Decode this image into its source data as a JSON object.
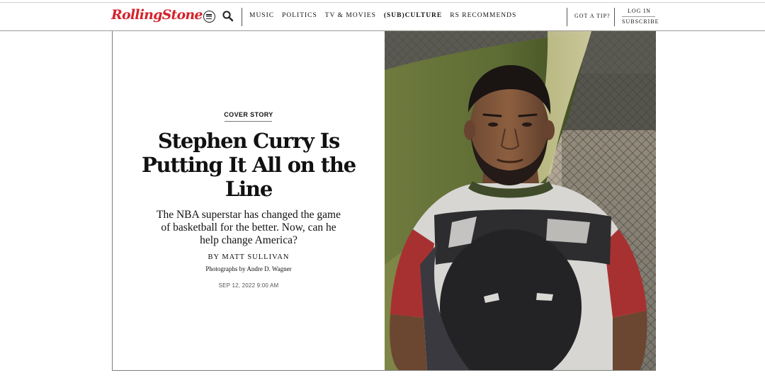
{
  "header": {
    "logo": "RollingStone",
    "nav": [
      "MUSIC",
      "POLITICS",
      "TV & MOVIES",
      "(SUB)CULTURE",
      "RS RECOMMENDS"
    ],
    "tip": "GOT A TIP?",
    "login": "LOG IN",
    "subscribe": "SUBSCRIBE"
  },
  "article": {
    "kicker": "COVER STORY",
    "headline": "Stephen Curry Is Putting It All on the Line",
    "dek": "The NBA superstar has changed the game of basketball for the better. Now, can he help change America?",
    "byline": "BY MATT SULLIVAN",
    "photo_credit": "Photographs by Andre D. Wagner",
    "date": "SEP 12, 2022 9:00 AM"
  },
  "icons": {
    "menu": "menu-icon",
    "search": "search-icon"
  },
  "colors": {
    "brand": "#d3232d"
  }
}
